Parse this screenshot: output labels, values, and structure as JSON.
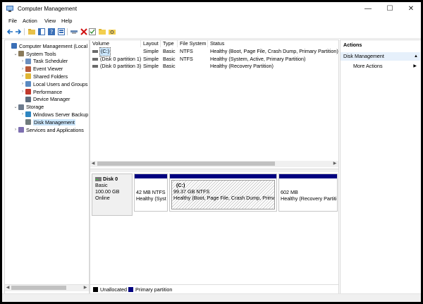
{
  "window": {
    "title": "Computer Management",
    "minimize": "—",
    "maximize": "☐",
    "close": "✕"
  },
  "menu": [
    "File",
    "Action",
    "View",
    "Help"
  ],
  "tree": [
    {
      "label": "Computer Management (Local",
      "indent": 0,
      "exp": "",
      "icon": "computer-icon"
    },
    {
      "label": "System Tools",
      "indent": 1,
      "exp": "⌄",
      "icon": "tools-icon"
    },
    {
      "label": "Task Scheduler",
      "indent": 2,
      "exp": "›",
      "icon": "clock-icon"
    },
    {
      "label": "Event Viewer",
      "indent": 2,
      "exp": "›",
      "icon": "event-icon"
    },
    {
      "label": "Shared Folders",
      "indent": 2,
      "exp": "›",
      "icon": "folder-icon"
    },
    {
      "label": "Local Users and Groups",
      "indent": 2,
      "exp": "›",
      "icon": "users-icon"
    },
    {
      "label": "Performance",
      "indent": 2,
      "exp": "›",
      "icon": "performance-icon"
    },
    {
      "label": "Device Manager",
      "indent": 2,
      "exp": "",
      "icon": "device-icon"
    },
    {
      "label": "Storage",
      "indent": 1,
      "exp": "⌄",
      "icon": "storage-icon"
    },
    {
      "label": "Windows Server Backup",
      "indent": 2,
      "exp": "›",
      "icon": "backup-icon"
    },
    {
      "label": "Disk Management",
      "indent": 2,
      "exp": "",
      "icon": "disk-icon"
    },
    {
      "label": "Services and Applications",
      "indent": 1,
      "exp": "›",
      "icon": "services-icon"
    }
  ],
  "volume_list": {
    "headers": [
      "Volume",
      "Layout",
      "Type",
      "File System",
      "Status"
    ],
    "rows": [
      {
        "volume": "(C:)",
        "layout": "Simple",
        "type": "Basic",
        "fs": "NTFS",
        "status": "Healthy (Boot, Page File, Crash Dump, Primary Partition)"
      },
      {
        "volume": "(Disk 0 partition 1)",
        "layout": "Simple",
        "type": "Basic",
        "fs": "NTFS",
        "status": "Healthy (System, Active, Primary Partition)"
      },
      {
        "volume": "(Disk 0 partition 3)",
        "layout": "Simple",
        "type": "Basic",
        "fs": "",
        "status": "Healthy (Recovery Partition)"
      }
    ]
  },
  "disk": {
    "name": "Disk 0",
    "type": "Basic",
    "size": "100.00 GB",
    "state": "Online",
    "partitions": [
      {
        "name": "",
        "size": "42 MB NTFS",
        "status": "Healthy (Syst"
      },
      {
        "name": "(C:)",
        "size": "99.37 GB NTFS",
        "status": "Healthy (Boot, Page File, Crash Dump, Primar"
      },
      {
        "name": "",
        "size": "602 MB",
        "status": "Healthy (Recovery Partiti"
      }
    ]
  },
  "legend": {
    "unallocated": "Unallocated",
    "primary": "Primary partition",
    "unallocated_color": "#000000",
    "primary_color": "#000080"
  },
  "actions": {
    "header": "Actions",
    "section": "Disk Management",
    "more": "More Actions"
  },
  "colors": {
    "selection": "#cce8ff",
    "accent": "#000080"
  }
}
